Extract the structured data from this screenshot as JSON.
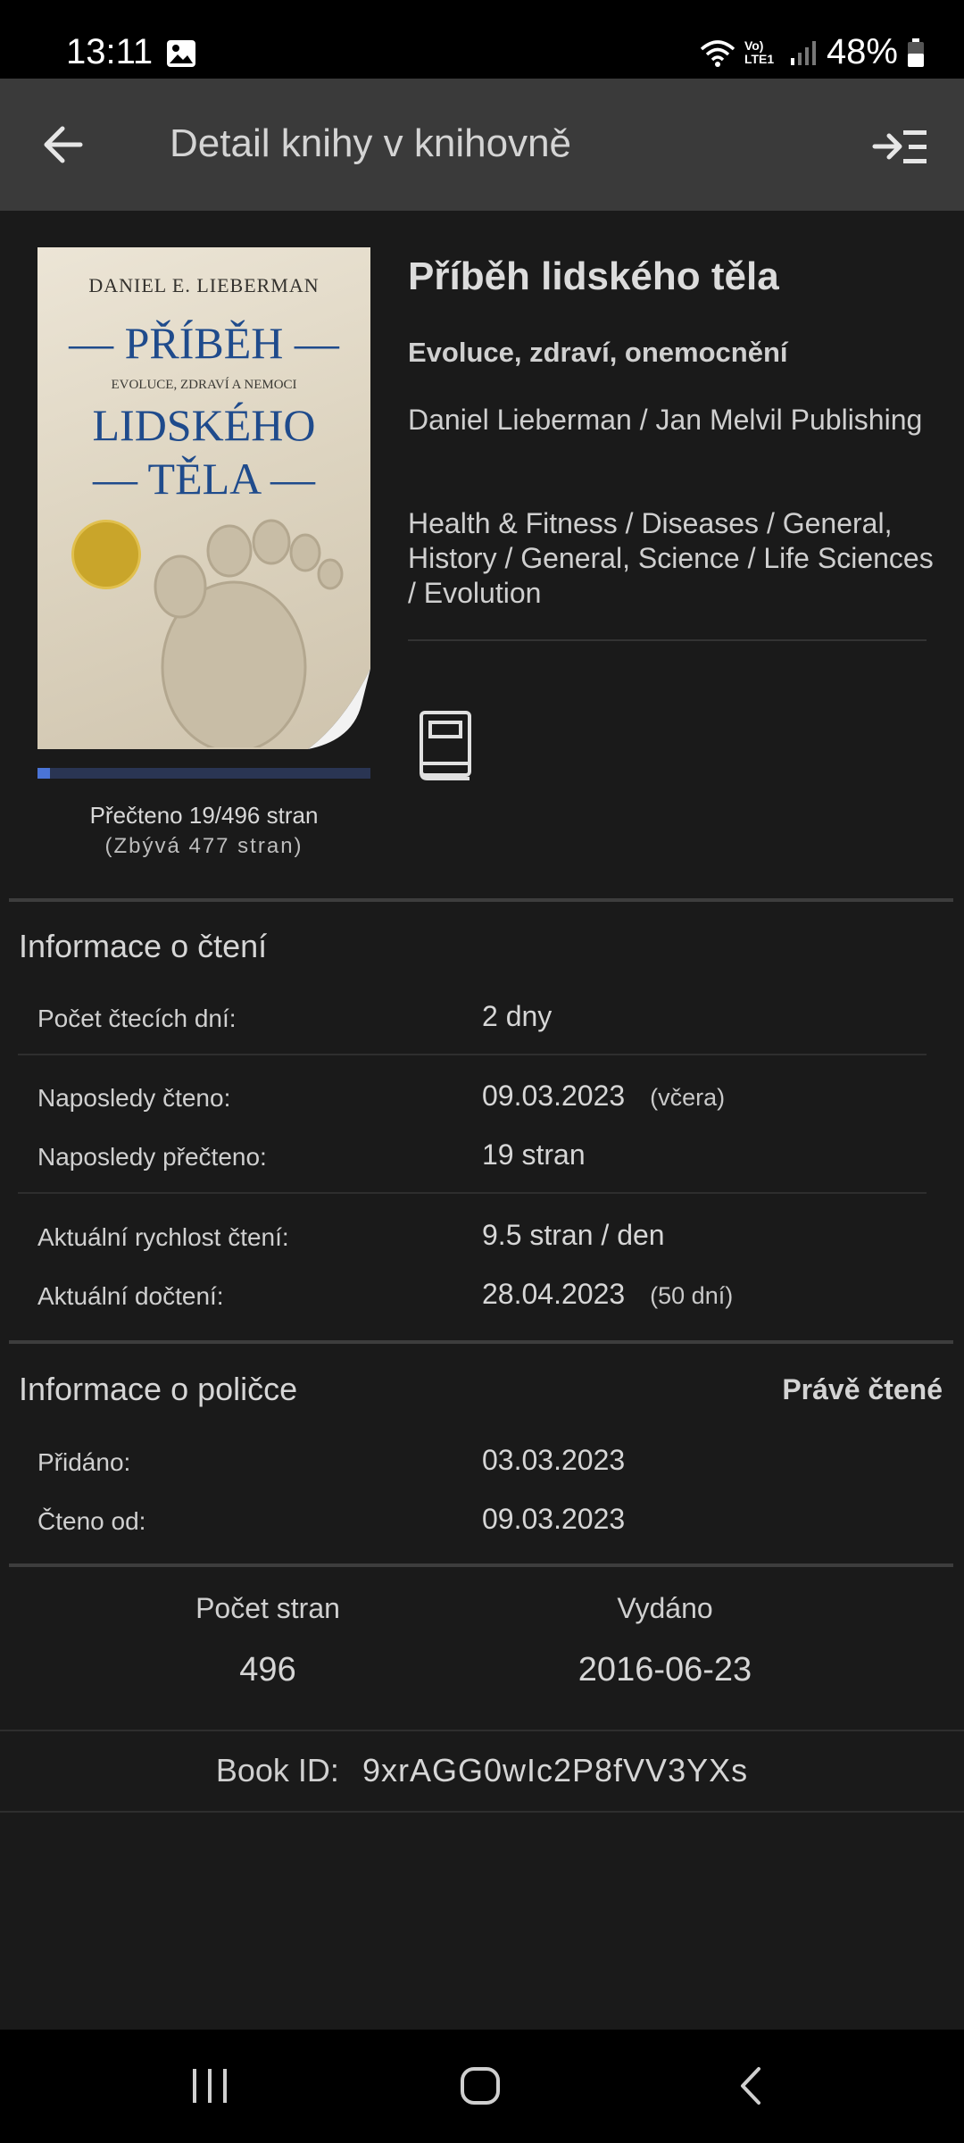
{
  "status_bar": {
    "time": "13:11",
    "network": "Vo) LTE1",
    "battery": "48%"
  },
  "app_bar": {
    "title": "Detail knihy v knihovně"
  },
  "cover": {
    "author": "DANIEL E. LIEBERMAN",
    "title_line_1": "— PŘÍBĚH —",
    "subtitle": "EVOLUCE, ZDRAVÍ A NEMOCI",
    "title_line_2": "LIDSKÉHO",
    "title_line_3": "— TĚLA —"
  },
  "progress": {
    "fraction": 0.038,
    "read_text": "Přečteno 19/496 stran",
    "remaining_text": "(Zbývá 477 stran)"
  },
  "book": {
    "title": "Příběh lidského těla",
    "subtitle": "Evoluce, zdraví, onemocnění",
    "author_publisher": "Daniel Lieberman / Jan Melvil Publishing",
    "genres": "Health & Fitness / Diseases / General, History / General, Science / Life Sciences / Evolution",
    "format_icon": "book-icon"
  },
  "reading_info": {
    "title": "Informace o čtení",
    "rows": [
      {
        "label": "Počet čtecích dní:",
        "value": "2 dny",
        "extra": ""
      },
      {
        "label": "Naposledy čteno:",
        "value": "09.03.2023",
        "extra": "(včera)"
      },
      {
        "label": "Naposledy přečteno:",
        "value": "19 stran",
        "extra": ""
      },
      {
        "label": "Aktuální rychlost čtení:",
        "value": "9.5 stran / den",
        "extra": ""
      },
      {
        "label": "Aktuální dočtení:",
        "value": "28.04.2023",
        "extra": "(50 dní)"
      }
    ]
  },
  "shelf_info": {
    "title": "Informace o poličce",
    "shelf": "Právě čtené",
    "rows": [
      {
        "label": "Přidáno:",
        "value": "03.03.2023"
      },
      {
        "label": "Čteno od:",
        "value": "09.03.2023"
      }
    ]
  },
  "stats": {
    "pages_label": "Počet stran",
    "pages_value": "496",
    "published_label": "Vydáno",
    "published_value": "2016-06-23"
  },
  "book_id": {
    "label": "Book ID:",
    "value": "9xrAGG0wIc2P8fVV3YXs"
  },
  "colors": {
    "background": "#1a1a1a",
    "app_bar": "#3a3a3a",
    "progress_fill": "#4a74d6",
    "progress_track": "#2a3553",
    "cover_blue": "#1f4b8c"
  }
}
